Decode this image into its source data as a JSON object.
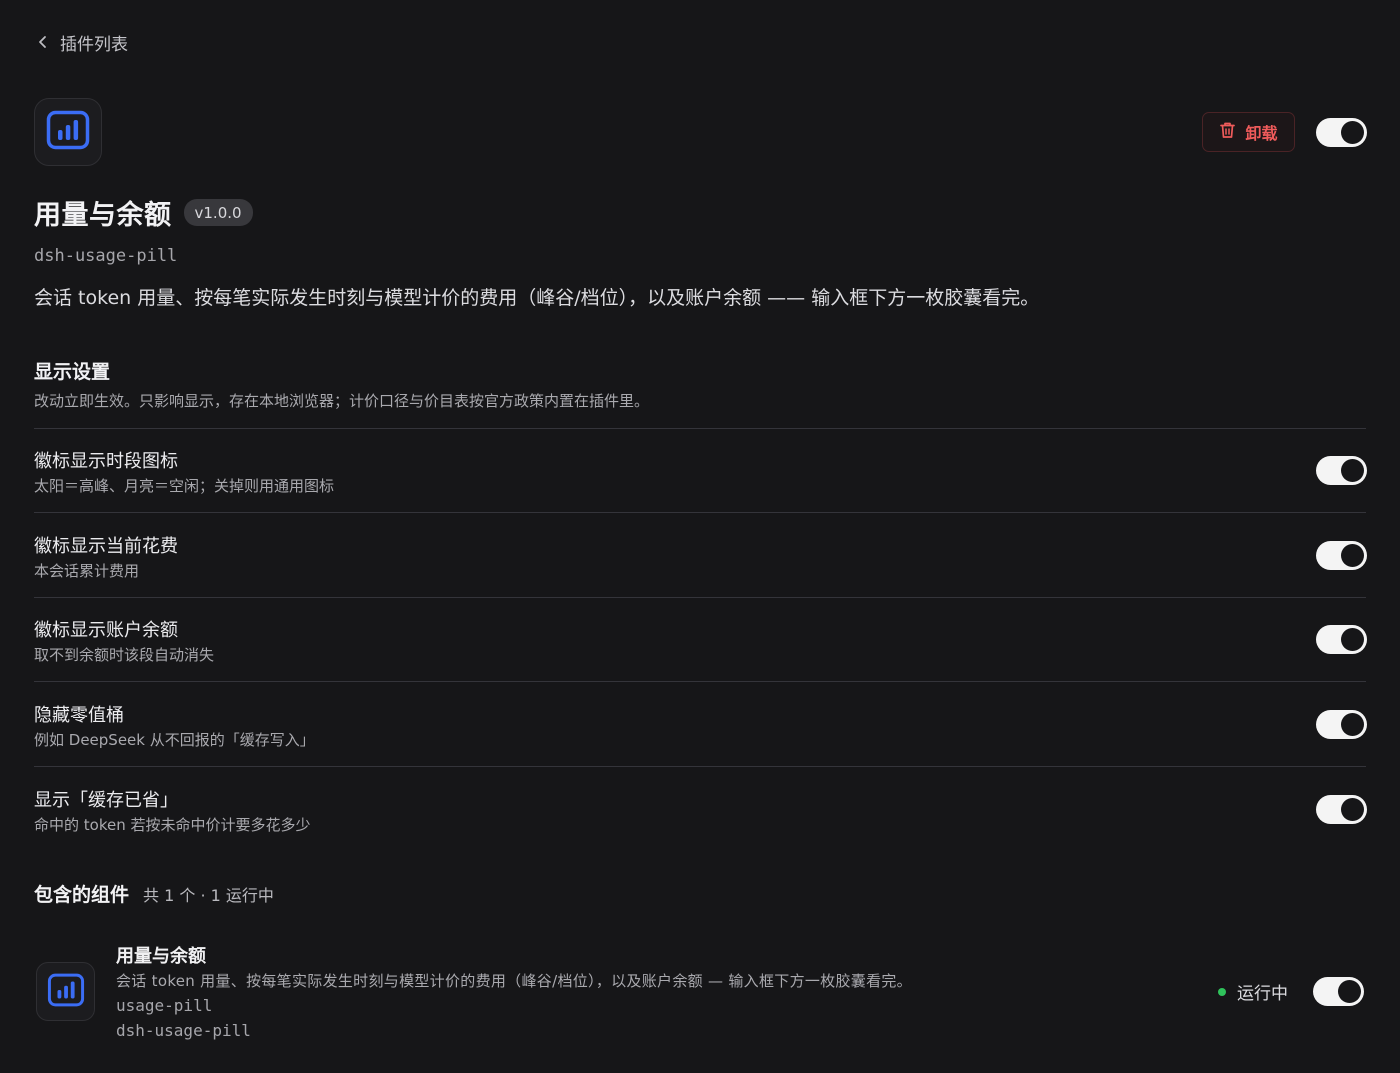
{
  "nav": {
    "back_label": "插件列表"
  },
  "plugin": {
    "icon": "bar-chart-icon",
    "title": "用量与余额",
    "version": "v1.0.0",
    "slug": "dsh-usage-pill",
    "description": "会话 token 用量、按每笔实际发生时刻与模型计价的费用（峰谷/档位），以及账户余额 —— 输入框下方一枚胶囊看完。",
    "enabled": true
  },
  "actions": {
    "uninstall_label": "卸载",
    "uninstall_icon": "trash-icon"
  },
  "display_settings": {
    "title": "显示设置",
    "subtitle": "改动立即生效。只影响显示，存在本地浏览器；计价口径与价目表按官方政策内置在插件里。",
    "items": [
      {
        "label": "徽标显示时段图标",
        "hint": "太阳＝高峰、月亮＝空闲；关掉则用通用图标",
        "enabled": true
      },
      {
        "label": "徽标显示当前花费",
        "hint": "本会话累计费用",
        "enabled": true
      },
      {
        "label": "徽标显示账户余额",
        "hint": "取不到余额时该段自动消失",
        "enabled": true
      },
      {
        "label": "隐藏零值桶",
        "hint": "例如 DeepSeek 从不回报的「缓存写入」",
        "enabled": true
      },
      {
        "label": "显示「缓存已省」",
        "hint": "命中的 token 若按未命中价计要多花多少",
        "enabled": true
      }
    ]
  },
  "components": {
    "title": "包含的组件",
    "count_label": "共 1 个 · 1 运行中",
    "items": [
      {
        "name": "用量与余额",
        "description": "会话 token 用量、按每笔实际发生时刻与模型计价的费用（峰谷/档位），以及账户余额 — 输入框下方一枚胶囊看完。",
        "id": "usage-pill",
        "plugin": "dsh-usage-pill",
        "status": "运行中",
        "enabled": true
      }
    ]
  },
  "colors": {
    "background": "#161618",
    "accent_blue": "#3b6df5",
    "danger": "#ef5b5b",
    "running": "#2fc25b",
    "toggle_on": "#f4f4f4"
  }
}
